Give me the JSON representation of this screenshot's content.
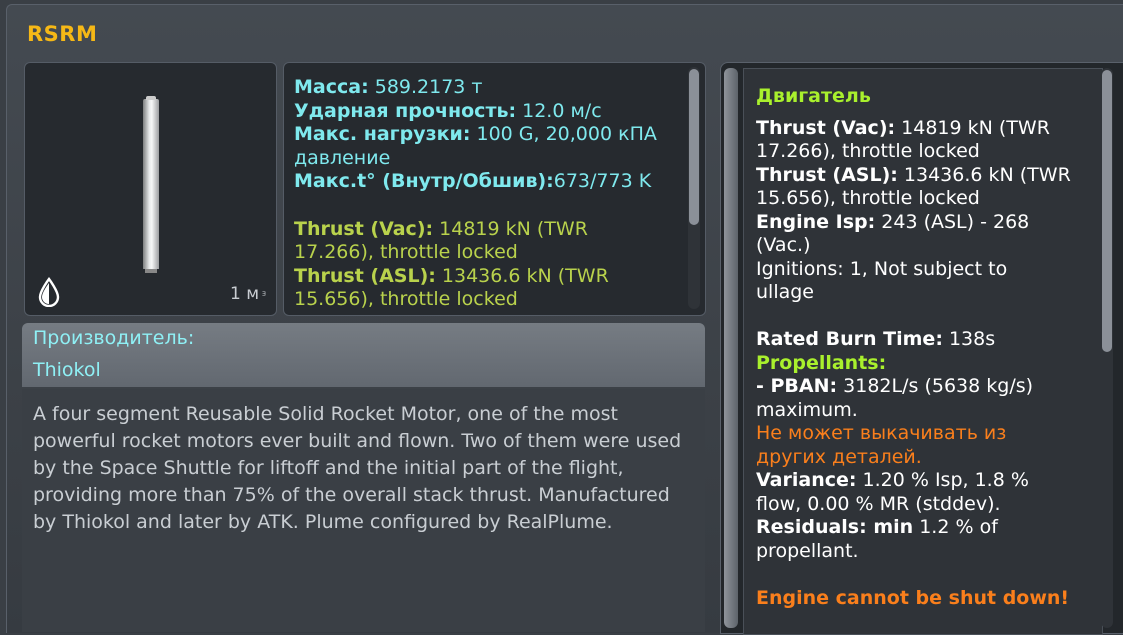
{
  "window": {
    "title": "RSRM"
  },
  "thumbnail": {
    "resource_icon": "drop-icon",
    "scale_value": "1 м",
    "scale_suffix": "ᴲ"
  },
  "stats": {
    "mass_label": "Масса:",
    "mass_value": "589.2173 т",
    "impact_label": "Ударная прочность:",
    "impact_value": "12.0 м/с",
    "load_label": "Макс. нагрузки:",
    "load_value": "100 G, 20,000 кПА",
    "load_value_2": "давление",
    "temp_label": "Макс.t° (Внутр/Обшив):",
    "temp_value": "673/773 K",
    "thrust_vac_label": "Thrust (Vac):",
    "thrust_vac_value": "14819 kN (TWR",
    "thrust_vac_value_2": "17.266), throttle locked",
    "thrust_asl_label": "Thrust (ASL):",
    "thrust_asl_value": "13436.6 kN (TWR",
    "thrust_asl_value_2": "15.656), throttle locked"
  },
  "manufacturer": {
    "label": "Производитель:",
    "value": "Thiokol"
  },
  "description": "A four segment Reusable Solid Rocket Motor, one of the most powerful rocket motors ever built and flown. Two of them were used by the Space Shuttle for liftoff and the initial part of the flight, providing more than 75% of the overall stack thrust. Manufactured by Thiokol and later by ATK. Plume configured by RealPlume.",
  "engine": {
    "heading": "Двигатель",
    "thrust_vac_label": "Thrust (Vac):",
    "thrust_vac_value": "14819 kN (TWR",
    "thrust_vac_value_2": "17.266), throttle locked",
    "thrust_asl_label": "Thrust (ASL):",
    "thrust_asl_value": "13436.6 kN (TWR",
    "thrust_asl_value_2": "15.656), throttle locked",
    "isp_label": "Engine Isp:",
    "isp_value": "243 (ASL) - 268",
    "isp_value_2": "(Vac.)",
    "ignitions": "Ignitions: 1, Not subject to",
    "ignitions_2": "ullage",
    "burn_label": "Rated Burn Time:",
    "burn_value": "138s",
    "propellants_label": "Propellants:",
    "pban_label": "- PBAN:",
    "pban_value": "3182L/s (5638 kg/s)",
    "pban_value_2": "maximum.",
    "no_pump": "Не может выкачивать из",
    "no_pump_2": "других деталей.",
    "variance_label": "Variance:",
    "variance_value": "1.20 % Isp, 1.8 %",
    "variance_value_2": "flow, 0.00 % MR (stddev).",
    "residuals_label": "Residuals: min",
    "residuals_value": "1.2 % of",
    "residuals_value_2": "propellant.",
    "no_shutdown": "Engine cannot be shut down!"
  },
  "colors": {
    "title": "#f6b816",
    "cyan": "#7fe9ee",
    "green": "#b9d24c",
    "lime": "#a9f02d",
    "orange": "#fa7f1c"
  }
}
